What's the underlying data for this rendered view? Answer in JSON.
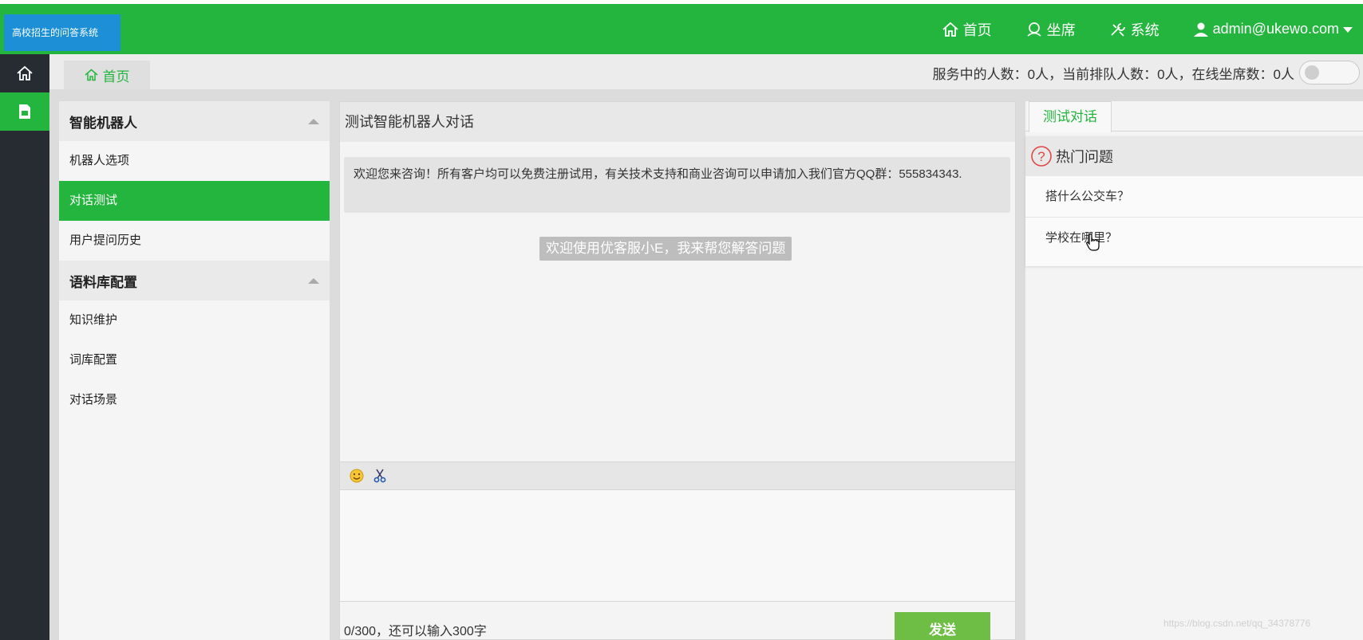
{
  "app": {
    "logo_text": "高校招生的问答系统"
  },
  "topnav": {
    "home": "首页",
    "seats": "坐席",
    "system": "系统",
    "user": "admin@ukewo.com"
  },
  "tabs": {
    "home": "首页"
  },
  "status": {
    "text": "服务中的人数：0人，当前排队人数：0人，在线坐席数：0人"
  },
  "menu": {
    "group1": "智能机器人",
    "group1_items": [
      "机器人选项",
      "对话测试",
      "用户提问历史"
    ],
    "group2": "语料库配置",
    "group2_items": [
      "知识维护",
      "词库配置",
      "对话场景"
    ],
    "active_item": "对话测试"
  },
  "chat": {
    "title": "测试智能机器人对话",
    "welcome_message": "欢迎您来咨询！所有客户均可以免费注册试用，有关技术支持和商业咨询可以申请加入我们官方QQ群：555834343.",
    "system_note": "欢迎使用优客服小E，我来帮您解答问题",
    "counter": "0/300，还可以输入300字",
    "send_label": "发送"
  },
  "right_panel": {
    "tab": "测试对话",
    "hot_title": "热门问题",
    "questions": [
      "搭什么公交车？",
      "学校在哪里？"
    ]
  },
  "watermark": "https://blog.csdn.net/qq_34378776",
  "colors": {
    "primary_green": "#23b53d",
    "logo_blue": "#1c8fd6",
    "sidebar_dark": "#272c33",
    "send_green": "#6ebd44"
  }
}
